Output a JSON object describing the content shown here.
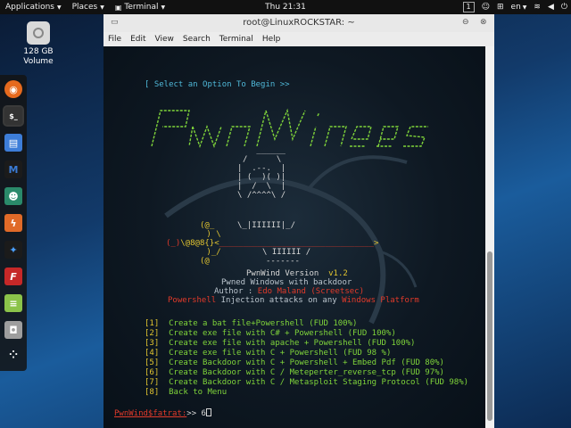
{
  "topbar": {
    "applications": "Applications",
    "places": "Places",
    "terminal": "Terminal",
    "clock": "Thu 21:31",
    "workspace": "1",
    "lang": "en"
  },
  "desktop": {
    "disk_label_1": "128 GB",
    "disk_label_2": "Volume"
  },
  "window": {
    "title": "root@LinuxROCKSTAR: ~",
    "menu": [
      "File",
      "Edit",
      "View",
      "Search",
      "Terminal",
      "Help"
    ]
  },
  "terminal": {
    "select_prompt": "[ Select an Option To Begin >>",
    "version_label": "PwnWind Version",
    "version_value": "v1.2",
    "tagline": "Pwned Windows with backdoor",
    "author_label": "Author :",
    "author_value": "Edo Maland (Screetsec)",
    "inject_a": "Powershell",
    "inject_b": "Injection attacks on any",
    "inject_c": "Windows Platform",
    "options": [
      {
        "num": "[1]",
        "text": "Create a bat file+Powershell (FUD 100%)"
      },
      {
        "num": "[2]",
        "text": "Create exe file with C# + Powershell (FUD 100%)"
      },
      {
        "num": "[3]",
        "text": "Create exe file with apache + Powershell (FUD 100%)"
      },
      {
        "num": "[4]",
        "text": "Create exe file with C + Powershell (FUD 98 %)"
      },
      {
        "num": "[5]",
        "text": "Create Backdoor with C + Powershell + Embed Pdf (FUD 80%)"
      },
      {
        "num": "[6]",
        "text": "Create Backdoor with C / Meteperter_reverse_tcp (FUD 97%)"
      },
      {
        "num": "[7]",
        "text": "Create Backdoor with C / Metasploit Staging Protocol (FUD 98%)"
      },
      {
        "num": "[8]",
        "text": "Back to Menu"
      }
    ],
    "prompt_label": "PwnWind$fatrat:",
    "prompt_arrow": ">>",
    "input_value": "6"
  },
  "colors": {
    "prompt_red": "#e23a2a",
    "option_green": "#7fd43a",
    "number_yellow": "#e2c530",
    "header_cyan": "#4fb8d8"
  }
}
